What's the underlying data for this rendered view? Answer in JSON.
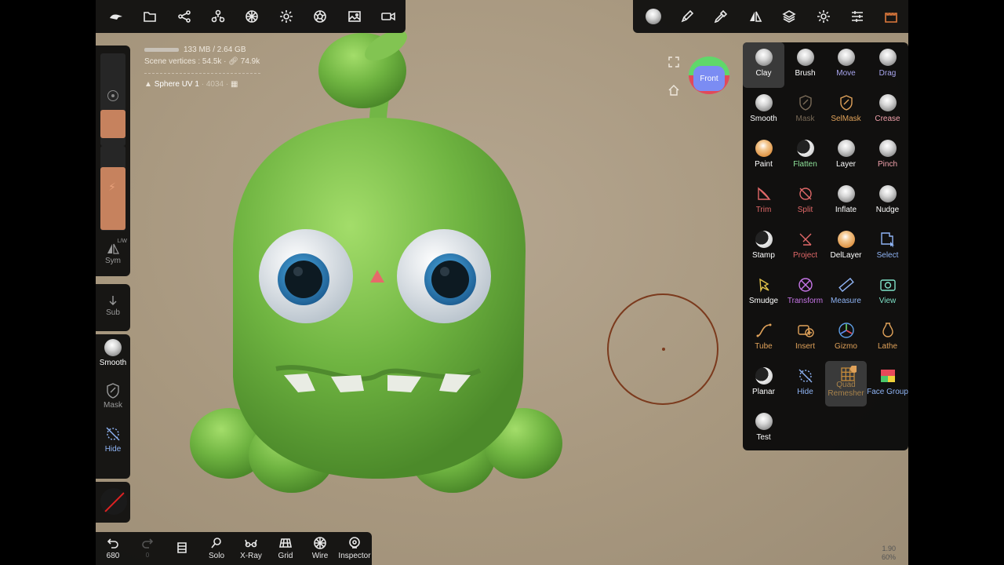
{
  "top_left_toolbar": [
    "logo-icon",
    "folder-icon",
    "share-icon",
    "scene-icon",
    "material-icon",
    "light-icon",
    "camera-icon",
    "image-icon",
    "video-icon"
  ],
  "top_right_toolbar": [
    "matcap-icon",
    "pen-icon",
    "eyedropper-icon",
    "symmetry-icon",
    "layers-icon",
    "settings-icon",
    "sliders-icon",
    "castle-icon"
  ],
  "info": {
    "memory": "133 MB / 2.64 GB",
    "scene_vertices": "Scene vertices : 54.5k · ",
    "faces": "74.9k",
    "mesh_name": "Sphere UV 1",
    "mesh_count": " · 4034 · "
  },
  "sidebar": {
    "sym_label": "Sym",
    "lw_label": "L/W",
    "sub_label": "Sub",
    "smooth_label": "Smooth",
    "mask_label": "Mask",
    "hide_label": "Hide",
    "swatch_color": "#c6825e"
  },
  "bottom_toolbar": {
    "undo_count": "680",
    "redo_count": "0",
    "items": [
      {
        "label": "Solo"
      },
      {
        "label": "X-Ray"
      },
      {
        "label": "Grid"
      },
      {
        "label": "Wire"
      },
      {
        "label": "Inspector"
      }
    ]
  },
  "view_cube": {
    "label": "Front"
  },
  "tools": [
    {
      "label": "Clay",
      "color": "#ffffff",
      "icon": "ball",
      "active": true
    },
    {
      "label": "Brush",
      "color": "#ffffff",
      "icon": "ball"
    },
    {
      "label": "Move",
      "color": "#a9a6ef",
      "icon": "ball"
    },
    {
      "label": "Drag",
      "color": "#a9a6ef",
      "icon": "ball"
    },
    {
      "label": "Smooth",
      "color": "#ffffff",
      "icon": "ball"
    },
    {
      "label": "Mask",
      "color": "#7a6b58",
      "icon": "mask-icon"
    },
    {
      "label": "SelMask",
      "color": "#e0a25a",
      "icon": "mask-icon"
    },
    {
      "label": "Crease",
      "color": "#f2a2ac",
      "icon": "ball"
    },
    {
      "label": "Paint",
      "color": "#ffffff",
      "icon": "ball-orange"
    },
    {
      "label": "Flatten",
      "color": "#8fe39a",
      "icon": "ball-dark"
    },
    {
      "label": "Layer",
      "color": "#ffffff",
      "icon": "ball"
    },
    {
      "label": "Pinch",
      "color": "#f2a2ac",
      "icon": "ball"
    },
    {
      "label": "Trim",
      "color": "#e06868",
      "icon": "trim-icon"
    },
    {
      "label": "Split",
      "color": "#e06868",
      "icon": "split-icon"
    },
    {
      "label": "Inflate",
      "color": "#ffffff",
      "icon": "ball"
    },
    {
      "label": "Nudge",
      "color": "#ffffff",
      "icon": "ball"
    },
    {
      "label": "Stamp",
      "color": "#ffffff",
      "icon": "ball-dark"
    },
    {
      "label": "Project",
      "color": "#e06868",
      "icon": "project-icon"
    },
    {
      "label": "DelLayer",
      "color": "#ffffff",
      "icon": "ball-orange"
    },
    {
      "label": "Select",
      "color": "#8fb4f5",
      "icon": "select-icon"
    },
    {
      "label": "Smudge",
      "color": "#ffffff",
      "icon": "smudge-icon"
    },
    {
      "label": "Transform",
      "color": "#c776e8",
      "icon": "transform-icon"
    },
    {
      "label": "Measure",
      "color": "#8fb4f5",
      "icon": "measure-icon"
    },
    {
      "label": "View",
      "color": "#7fe2c8",
      "icon": "camera-icon"
    },
    {
      "label": "Tube",
      "color": "#e0a25a",
      "icon": "tube-icon"
    },
    {
      "label": "Insert",
      "color": "#e0a25a",
      "icon": "insert-icon"
    },
    {
      "label": "Gizmo",
      "color": "#e0a25a",
      "icon": "gizmo-icon"
    },
    {
      "label": "Lathe",
      "color": "#e0a25a",
      "icon": "lathe-icon"
    },
    {
      "label": "Planar",
      "color": "#ffffff",
      "icon": "ball-dark"
    },
    {
      "label": "Hide",
      "color": "#8fb4f5",
      "icon": "hide-icon"
    },
    {
      "label": "Quad\nRemesher",
      "color": "#a8824a",
      "icon": "quad-remesher-icon",
      "active": true
    },
    {
      "label": "Face Group",
      "color": "#8fb4f5",
      "icon": "face-group-icon"
    },
    {
      "label": "Test",
      "color": "#ffffff",
      "icon": "ball"
    }
  ],
  "zoom": {
    "scale": "1.90",
    "percent": "60%"
  }
}
